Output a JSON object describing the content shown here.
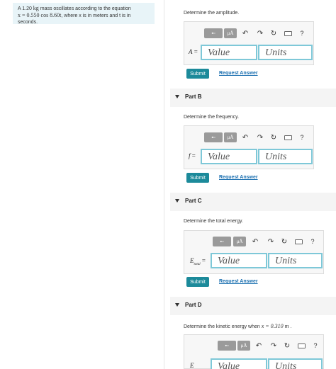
{
  "problem": {
    "line1_pre": "A 1.20 ",
    "line1_unit": "kg",
    "line1_post": " mass oscillates according to the equation",
    "line2_eq": "x = 0.550 cos 8.60t",
    "line2_post": ", where x is in meters and t is in",
    "line3": "seconds."
  },
  "toolbar": {
    "matrix_icon": "template-icon",
    "mu_label": "μÅ",
    "undo": "↶",
    "redo": "↷",
    "reset": "↻",
    "keyboard": "keyboard-icon",
    "help": "?"
  },
  "partA": {
    "prompt": "Determine the amplitude.",
    "var": "A",
    "eq": " =",
    "value_placeholder": "Value",
    "units_placeholder": "Units",
    "submit": "Submit",
    "request": "Request Answer"
  },
  "partB": {
    "title": "Part B",
    "prompt": "Determine the frequency.",
    "var": "f",
    "eq": " =",
    "value_placeholder": "Value",
    "units_placeholder": "Units",
    "submit": "Submit",
    "request": "Request Answer"
  },
  "partC": {
    "title": "Part C",
    "prompt": "Determine the total energy.",
    "var": "E",
    "sub": "total",
    "eq": " =",
    "value_placeholder": "Value",
    "units_placeholder": "Units",
    "submit": "Submit",
    "request": "Request Answer"
  },
  "partD": {
    "title": "Part D",
    "prompt_pre": "Determine the kinetic energy when ",
    "prompt_math": "x = 0.310 m",
    "prompt_post": " .",
    "var": "E",
    "value_placeholder": "Value",
    "units_placeholder": "Units"
  }
}
